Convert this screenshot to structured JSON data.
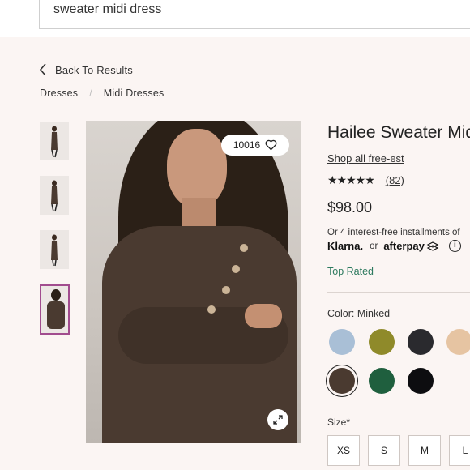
{
  "search": {
    "value": "sweater midi dress"
  },
  "nav": {
    "back_label": "Back To Results"
  },
  "breadcrumb": [
    "Dresses",
    "Midi Dresses"
  ],
  "gallery": {
    "thumbnail_count": 4,
    "selected_index": 3,
    "favorite_count": "10016"
  },
  "product": {
    "title": "Hailee Sweater Midi",
    "brand_link": "Shop all free-est",
    "rating": 4.5,
    "stars_text": "★★★★★",
    "review_count": "(82)",
    "price": "$98.00",
    "installments": "Or 4 interest-free installments of",
    "klarna": "Klarna.",
    "or_text": "or",
    "afterpay": "afterpay",
    "info_glyph": "i",
    "badge": "Top Rated",
    "color_label": "Color: Minked",
    "swatches": [
      {
        "name": "light-blue",
        "color": "#a9bfd6"
      },
      {
        "name": "olive",
        "color": "#8f8a2a"
      },
      {
        "name": "black-textured",
        "color": "#2a2a2e"
      },
      {
        "name": "tan",
        "color": "#e6c4a2"
      },
      {
        "name": "minked",
        "color": "#4a3a30",
        "selected": true
      },
      {
        "name": "green",
        "color": "#1f5f3e"
      },
      {
        "name": "black",
        "color": "#0d0d10"
      }
    ],
    "size_label": "Size*",
    "sizes": [
      "XS",
      "S",
      "M",
      "L"
    ]
  },
  "colors": {
    "accent": "#a14c8e",
    "top_rated": "#2d7a5f",
    "page_bg": "#fbf5f3"
  }
}
